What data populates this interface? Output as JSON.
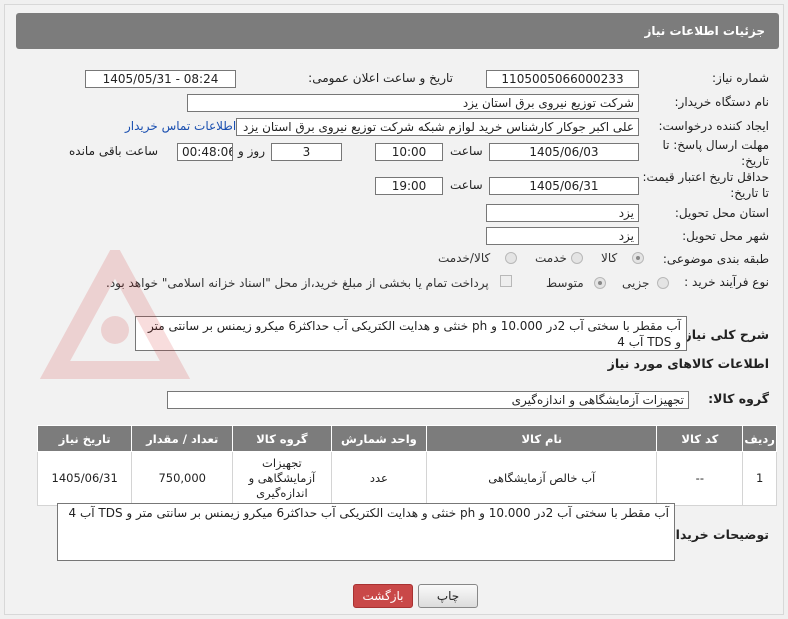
{
  "header": {
    "title": "جزئیات اطلاعات نیاز"
  },
  "fields": {
    "need_number_label": "شماره نیاز:",
    "need_number": "1105005066000233",
    "announce_label": "تاریخ و ساعت اعلان عمومی:",
    "announce_value": "1405/05/31 - 08:24",
    "buyer_org_label": "نام دستگاه خریدار:",
    "buyer_org": "شرکت توزیع نیروی برق استان یزد",
    "creator_label": "ایجاد کننده درخواست:",
    "creator": "علی اکبر جوکار  کارشناس خرید لوازم شبکه  شرکت توزیع نیروی برق استان یزد",
    "contact_link": "اطلاعات تماس خریدار",
    "reply_deadline_label": "مهلت ارسال پاسخ: تا تاریخ:",
    "reply_date": "1405/06/03",
    "time_label": "ساعت",
    "reply_time": "10:00",
    "days_value": "3",
    "days_label": "روز و",
    "remaining_time": "00:48:06",
    "remaining_label": "ساعت باقی مانده",
    "price_deadline_label": "حداقل تاریخ اعتبار قیمت: تا تاریخ:",
    "price_date": "1405/06/31",
    "price_time": "19:00",
    "province_label": "استان محل تحویل:",
    "province": "یزد",
    "city_label": "شهر محل تحویل:",
    "city": "یزد",
    "category_label": "طبقه بندی موضوعی:",
    "category_options": [
      "کالا",
      "خدمت",
      "کالا/خدمت"
    ],
    "process_label": "نوع فرآیند خرید :",
    "process_options": [
      "جزیی",
      "متوسط"
    ],
    "payment_note": "پرداخت تمام یا بخشی از مبلغ خرید،از محل \"اسناد خزانه اسلامی\" خواهد بود."
  },
  "summary": {
    "label": "شرح کلی نیاز:",
    "text": "آب مقطر با سختی آب 2در 10.000 و ph خنثی و  هدایت الکتریکی آب حداکثر6  میکرو زیمنس بر سانتی متر  و  TDS آب 4"
  },
  "goods_info_title": "اطلاعات کالاهای مورد نیاز",
  "goods_group": {
    "label": "گروه کالا:",
    "value": "تجهیزات آزمایشگاهی و اندازه‌گیری"
  },
  "table": {
    "headers": [
      "ردیف",
      "کد کالا",
      "نام کالا",
      "واحد شمارش",
      "گروه کالا",
      "تعداد / مقدار",
      "تاریخ نیاز"
    ],
    "rows": [
      [
        "1",
        "--",
        "آب خالص آزمایشگاهی",
        "عدد",
        "تجهیزات آزمایشگاهی و اندازه‌گیری",
        "750,000",
        "1405/06/31"
      ]
    ]
  },
  "buyer_notes": {
    "label": "توضیحات خریدار:",
    "text": "آب مقطر با سختی آب 2در 10.000 و ph خنثی و  هدایت الکتریکی آب حداکثر6  میکرو زیمنس بر سانتی متر    و  TDS آب 4"
  },
  "buttons": {
    "print": "چاپ",
    "back": "بازگشت"
  },
  "colors": {
    "header_bg": "#7c7c7c",
    "back_button": "#c94848",
    "link": "#1a4fb0"
  }
}
